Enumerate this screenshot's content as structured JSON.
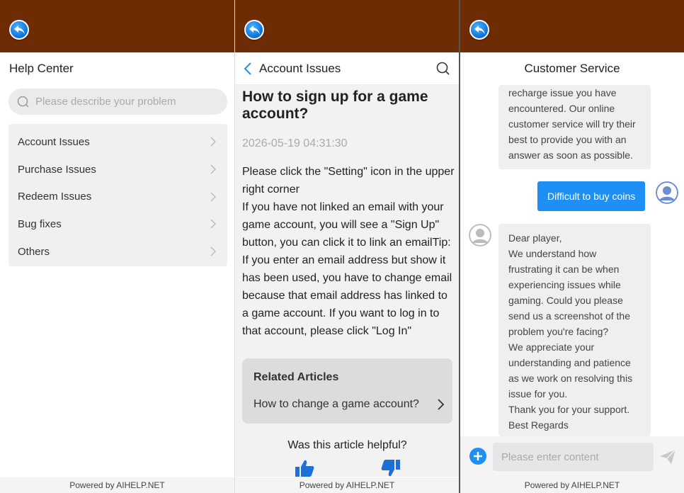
{
  "footer_text": "Powered by AIHELP.NET",
  "help_center": {
    "title": "Help Center",
    "search_placeholder": "Please describe your problem",
    "categories": [
      "Account Issues",
      "Purchase Issues",
      "Redeem Issues",
      "Bug fixes",
      "Others"
    ]
  },
  "article_page": {
    "header_title": "Account Issues",
    "title": "How to sign up for a game account?",
    "date": "2026-05-19 04:31:30",
    "body": [
      "Please click the \"Setting\" icon in the upper right corner",
      "If you have not linked an email with your game account, you will see a \"Sign Up\" button, you can click it to link an emailTip:",
      "If you enter an email address but show it has been used, you have to change email because that email address has linked to a game account. If you want to log in to that account, please click \"Log In\""
    ],
    "related_title": "Related Articles",
    "related_link": "How to change a game account?",
    "helpful_question": "Was this article helpful?"
  },
  "customer_service": {
    "title": "Customer Service",
    "message_1_partial": [
      "recharge issue you have",
      "encountered. Our online",
      "customer service will try their",
      "best to provide you with an",
      "answer as soon as possible."
    ],
    "user_message": "Difficult to buy coins",
    "message_2": [
      "Dear player,",
      "We understand how",
      "frustrating it can be when",
      "experiencing issues while",
      "gaming. Could you please",
      "send us a screenshot of the",
      "problem you're facing?",
      "We appreciate your",
      "understanding and patience",
      "as we work on resolving this",
      "issue for you.",
      "Thank you for your support.",
      "Best Regards"
    ],
    "input_placeholder": "Please enter content"
  },
  "colors": {
    "topbar": "#6e2c05",
    "accent_blue": "#1e90f5",
    "user_bubble": "#1e90f5"
  },
  "icons": [
    "back-arrow-icon",
    "search-icon",
    "chevron-right-icon",
    "chevron-left-icon",
    "thumbs-up-icon",
    "thumbs-down-icon",
    "plus-icon",
    "send-icon",
    "avatar-icon"
  ]
}
